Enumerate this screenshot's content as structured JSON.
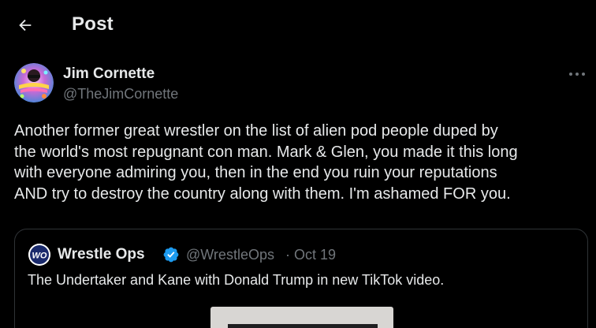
{
  "header": {
    "back_icon": "arrow-left-icon",
    "title": "Post"
  },
  "post": {
    "author": {
      "name": "Jim Cornette",
      "handle": "@TheJimCornette",
      "avatar_icon": "profile-avatar"
    },
    "more_icon": "ellipsis-icon",
    "text": "Another former great wrestler on the list of alien pod people duped by\nthe world's most repugnant con man. Mark & Glen, you made it this long\nwith everyone admiring you, then in the end you ruin your reputations\nAND try to destroy the country along with them. I'm ashamed FOR you."
  },
  "quoted_post": {
    "author": {
      "name": "Wrestle Ops",
      "handle": "@WrestleOps",
      "separator": "·",
      "date": "Oct 19",
      "avatar_text": "WO",
      "verified_icon": "verified-badge-icon"
    },
    "text": "The Undertaker and Kane with Donald Trump in new TikTok video."
  },
  "colors": {
    "background": "#000000",
    "primary_text": "#e7e9ea",
    "secondary_text": "#71767b",
    "border": "#2f3336",
    "verified": "#1d9bf0"
  }
}
